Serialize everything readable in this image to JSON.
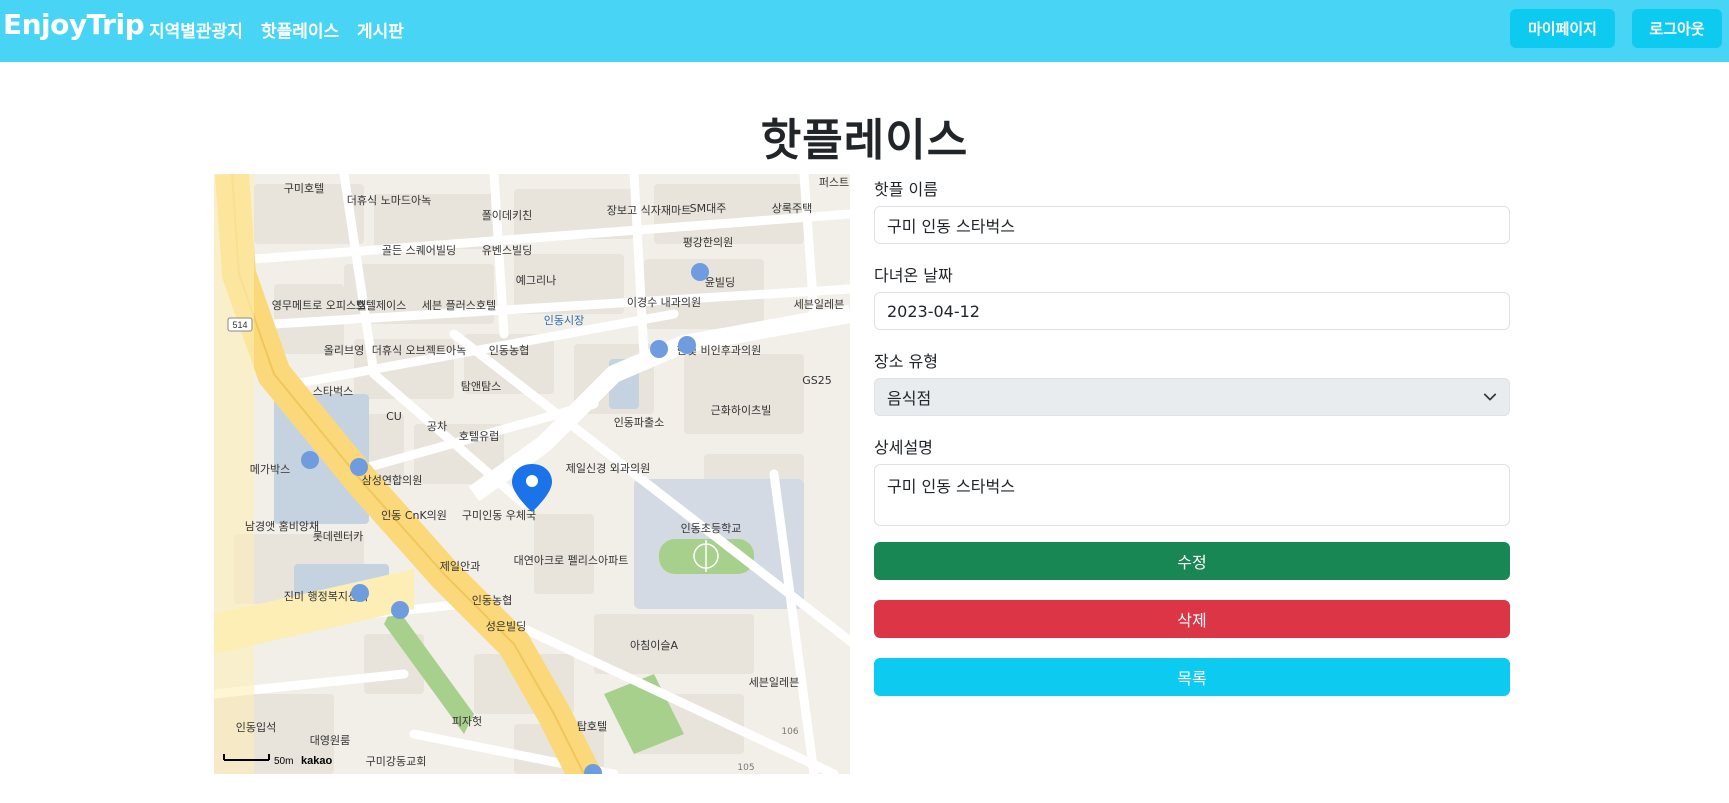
{
  "nav": {
    "brand": "EnjoyTrip",
    "links": [
      "지역별관광지",
      "핫플레이스",
      "게시판"
    ],
    "mypage_label": "마이페이지",
    "logout_label": "로그아웃"
  },
  "page": {
    "title": "핫플레이스"
  },
  "map": {
    "marker_label": "스타벅스",
    "route_number": "514",
    "scale_label": "50m",
    "attribution": "kakao",
    "labels": [
      "구미호텔",
      "더휴식 노마드아녹",
      "폴이데키친",
      "장보고 식자재마트",
      "SM대주",
      "상록주택",
      "퍼스트",
      "골든 스퀘어빌딩",
      "유벤스빌딩",
      "평강한의원",
      "예그리나",
      "윤빌딩",
      "영무메트로 오피스텔",
      "호텔제이스",
      "세븐 플러스호텔",
      "인동시장",
      "이경수 내과의원",
      "세븐일레븐",
      "한빛 비인후과의원",
      "올리브영",
      "더휴식 오브젝트아녹",
      "인동농협",
      "GS25",
      "스타벅스",
      "탐앤탐스",
      "인동파출소",
      "근화하이츠빌",
      "CU",
      "공차",
      "호텔유럽",
      "메가박스",
      "삼성연합의원",
      "제일신경 외과의원",
      "인동 CnK의원",
      "구미인동 우체국",
      "인동초등학교",
      "남경앳 홈비앙채",
      "롯데렌터카",
      "대연아크로 펠리스아파트",
      "제일안과",
      "진미 행정복지센터",
      "인동농협",
      "성은빌딩",
      "아침이슬A",
      "세븐일레븐",
      "피자헛",
      "인동입석",
      "대영원룸",
      "탑호텔",
      "구미강동교회",
      "106",
      "105"
    ]
  },
  "form": {
    "name_label": "핫플 이름",
    "name_value": "구미 인동 스타벅스",
    "date_label": "다녀온 날짜",
    "date_value": "2023-04-12",
    "type_label": "장소 유형",
    "type_value": "음식점",
    "desc_label": "상세설명",
    "desc_value": "구미 인동 스타벅스",
    "edit_label": "수정",
    "delete_label": "삭제",
    "list_label": "목록"
  },
  "colors": {
    "navbar": "#48d5f5",
    "info": "#0dcaf0",
    "success": "#198754",
    "danger": "#dc3545",
    "road_main": "#fbd97a",
    "marker": "#1a73e8"
  }
}
